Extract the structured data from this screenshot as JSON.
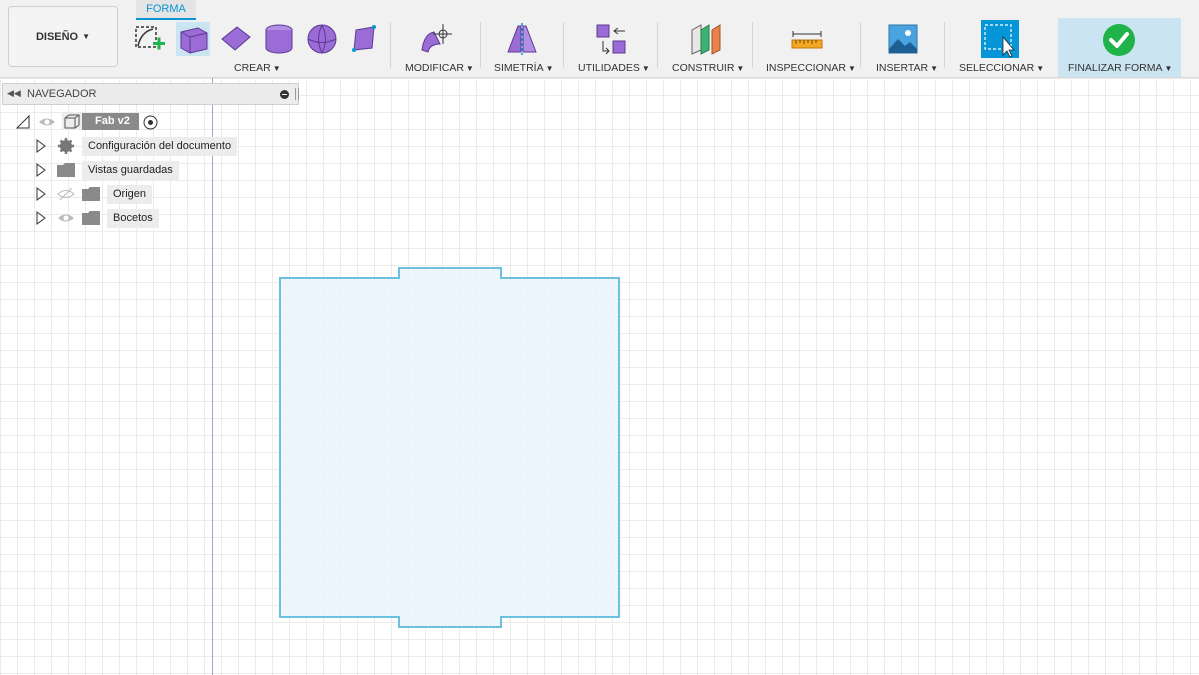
{
  "toolbar": {
    "workspace_label": "DISEÑO",
    "active_tab": "FORMA",
    "groups": [
      {
        "label": "CREAR"
      },
      {
        "label": "MODIFICAR"
      },
      {
        "label": "SIMETRÍA"
      },
      {
        "label": "UTILIDADES"
      },
      {
        "label": "CONSTRUIR"
      },
      {
        "label": "INSPECCIONAR"
      },
      {
        "label": "INSERTAR"
      },
      {
        "label": "SELECCIONAR"
      },
      {
        "label": "FINALIZAR FORMA"
      }
    ],
    "colors": {
      "accent": "#0696d7",
      "form_purple": "#9b6bd6",
      "finish_green": "#1fb34a"
    }
  },
  "navigator": {
    "title": "NAVEGADOR",
    "root": {
      "label": "Fab v2"
    },
    "items": [
      {
        "label": "Configuración del documento",
        "icon": "gear-icon"
      },
      {
        "label": "Vistas guardadas",
        "icon": "folder-icon"
      },
      {
        "label": "Origen",
        "icon": "folder-icon",
        "visibility": "hidden"
      },
      {
        "label": "Bocetos",
        "icon": "folder-icon",
        "visibility": "visible"
      }
    ]
  },
  "canvas": {
    "sketch_color": "#6cc0dd",
    "sketch_fill": "#eaf5fb"
  }
}
